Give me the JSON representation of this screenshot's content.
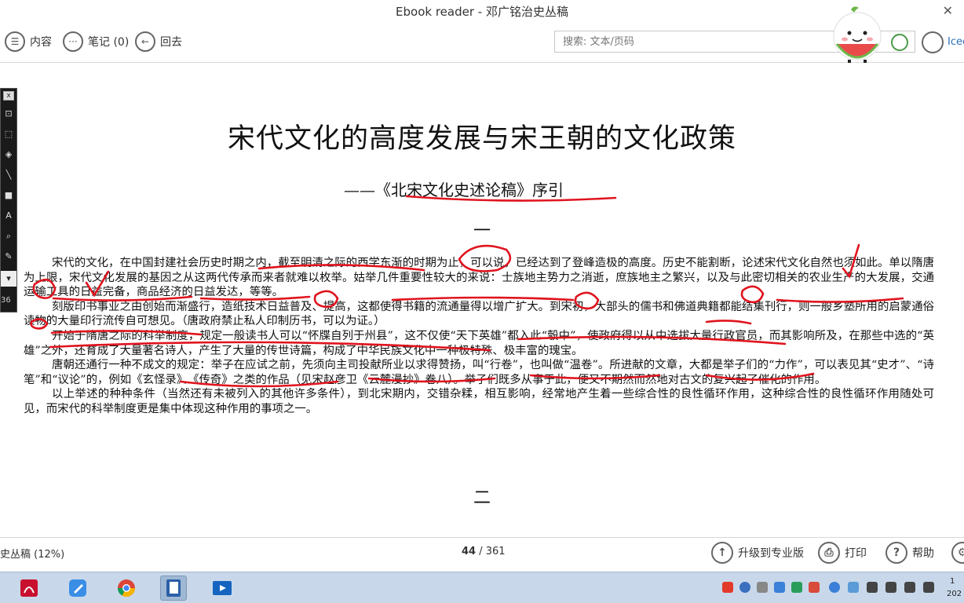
{
  "window": {
    "title": "Ebook reader - 邓广铭治史丛稿"
  },
  "toolbar": {
    "contents_label": "内容",
    "notes_label": "笔记 (0)",
    "back_label": "回去",
    "search_placeholder": "搜索: 文本/页码",
    "user_label": "Icec"
  },
  "document": {
    "title": "宋代文化的高度发展与宋王朝的文化政策",
    "subtitle_prefix": "——《",
    "subtitle_book": "北宋文化史述论稿",
    "subtitle_suffix": "》序引",
    "section_one": "一",
    "section_two": "二",
    "paragraphs": [
      "宋代的文化，在中国封建社会历史时期之内，截至明清之际的西学东渐的时期为止，可以说，已经达到了登峰造极的高度。历史不能割断，论述宋代文化自然也须如此。单以隋唐为上限，宋代文化发展的基因之从这两代传承而来者就难以枚举。姑举几件重要性较大的来说：士族地主势力之消逝，庶族地主之繁兴，以及与此密切相关的农业生产的大发展，交通运输工具的日益完备，商品经济的日益发达，等等。",
      "刻版印书事业之由创始而渐盛行，造纸技术日益普及、提高，这都使得书籍的流通量得以增广扩大。到宋初，大部头的儒书和佛道典籍都能结集刊行，则一般乡塾所用的启蒙通俗读物的大量印行流传自可想见。（唐政府禁止私人印制历书，可以为证。）",
      "开始于隋唐之际的科举制度，规定一般读书人可以“怀牒自列于州县”，这不仅使“天下英雄”都入此“彀中”，使政府得以从中选拔大量行政官员，而其影响所及，在那些中选的“英雄”之外，还育成了大量著名诗人，产生了大量的传世诗篇，构成了中华民族文化中一种极特殊、极丰富的瑰宝。",
      "唐朝还通行一种不成文的规定：举子在应试之前，先须向主司投献所业以求得赞扬，叫“行卷”，也叫做“温卷”。所进献的文章，大都是举子们的“力作”，可以表见其“史才”、“诗笔”和“议论”的，例如《玄怪录》、《传奇》之类的作品（见宋赵彦卫《云麓漫抄》卷八）。举子们既多从事于此，便又不期然而然地对古文的复兴起了催化的作用。",
      "以上举述的种种条件（当然还有未被列入的其他许多条件），到北宋期内，交错杂糅，相互影响，经常地产生着一些综合性的良性循环作用，这种综合性的良性循环作用随处可见，而宋代的科举制度更是集中体现这种作用的事项之一。"
    ]
  },
  "palette": {
    "counter": "36"
  },
  "statusbar": {
    "book_progress": "史丛稿 (12%)",
    "current_page": "44",
    "page_sep": " / 361",
    "upgrade_label": "升级到专业版",
    "print_label": "打印",
    "help_label": "帮助"
  },
  "taskbar": {
    "apps": [
      "pdf-app-icon",
      "notes-app-icon",
      "chrome-icon",
      "ebook-reader-icon",
      "video-app-icon"
    ],
    "clock_line1": "1",
    "clock_line2": "202"
  },
  "colors": {
    "annotation_red": "#e0141e",
    "link_blue": "#2a6fb8",
    "taskbar": "#c8d8ea"
  }
}
